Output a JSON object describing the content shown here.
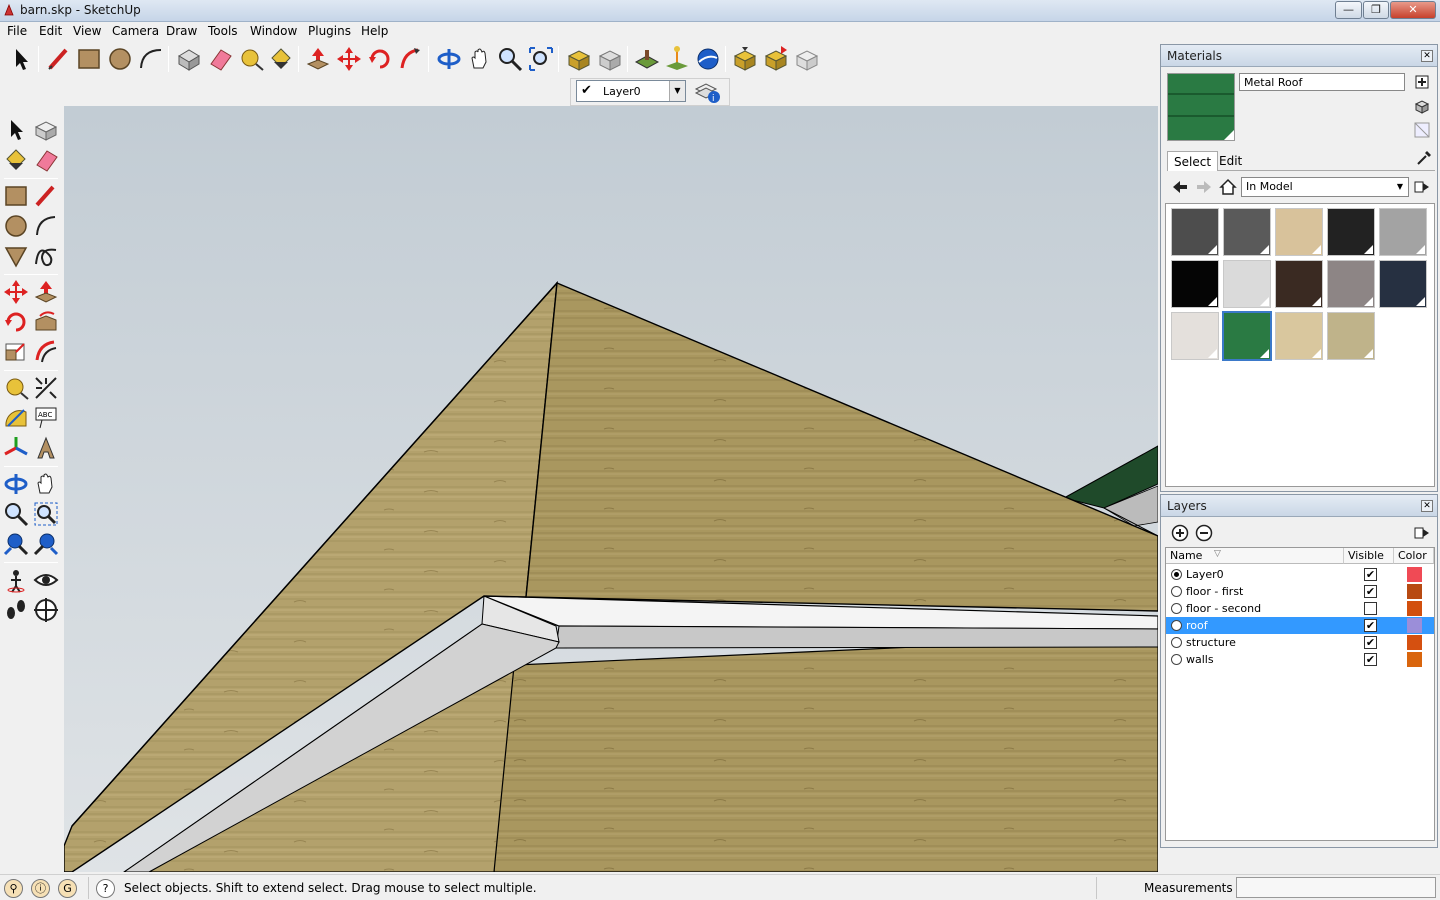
{
  "window": {
    "title": "barn.skp - SketchUp",
    "min": "—",
    "max": "❐",
    "close": "✕"
  },
  "menu": [
    "File",
    "Edit",
    "View",
    "Camera",
    "Draw",
    "Tools",
    "Window",
    "Plugins",
    "Help"
  ],
  "layer_toolbar": {
    "current_layer": "Layer0",
    "check": "✔",
    "dropdown": "▼"
  },
  "materials": {
    "title": "Materials",
    "close": "✕",
    "current_name": "Metal Roof",
    "tabs": [
      "Select",
      "Edit"
    ],
    "collection": "In Model",
    "dropdown": "▼",
    "swatch_colors": [
      "#4d4d4d",
      "#5a5a5a",
      "#d8c29b",
      "#222222",
      "#a3a3a3",
      "#050505",
      "#dadada",
      "#3a2a22",
      "#8d8585",
      "#263041",
      "#e4e0dc",
      "#2a7a43",
      "#d9c79e",
      "#bfb38a"
    ]
  },
  "layers": {
    "title": "Layers",
    "close": "✕",
    "headers": {
      "name": "Name",
      "visible": "Visible",
      "color": "Color"
    },
    "rows": [
      {
        "name": "Layer0",
        "active": true,
        "visible": true,
        "color": "#f04a55"
      },
      {
        "name": "floor - first",
        "active": false,
        "visible": true,
        "color": "#b84a12"
      },
      {
        "name": "floor - second",
        "active": false,
        "visible": false,
        "color": "#d24f0d"
      },
      {
        "name": "roof",
        "active": false,
        "visible": true,
        "color": "#9b8ed9",
        "selected": true
      },
      {
        "name": "structure",
        "active": false,
        "visible": true,
        "color": "#d55010"
      },
      {
        "name": "walls",
        "active": false,
        "visible": true,
        "color": "#d9650d"
      }
    ],
    "check": "✔"
  },
  "status": {
    "text": "Select objects. Shift to extend select. Drag mouse to select multiple.",
    "help_icon": "?",
    "measurements_label": "Measurements"
  }
}
